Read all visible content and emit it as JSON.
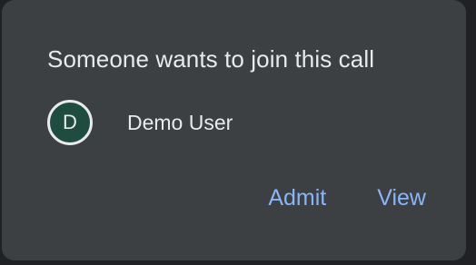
{
  "dialog": {
    "title": "Someone wants to join this call",
    "requester": {
      "avatar_initial": "D",
      "name": "Demo User"
    },
    "actions": {
      "admit_label": "Admit",
      "view_label": "View"
    }
  },
  "colors": {
    "dialog_bg": "#3c4043",
    "page_bg": "#202124",
    "text": "#e8eaed",
    "accent": "#8ab4f8",
    "avatar_bg": "#1e4d3f"
  }
}
